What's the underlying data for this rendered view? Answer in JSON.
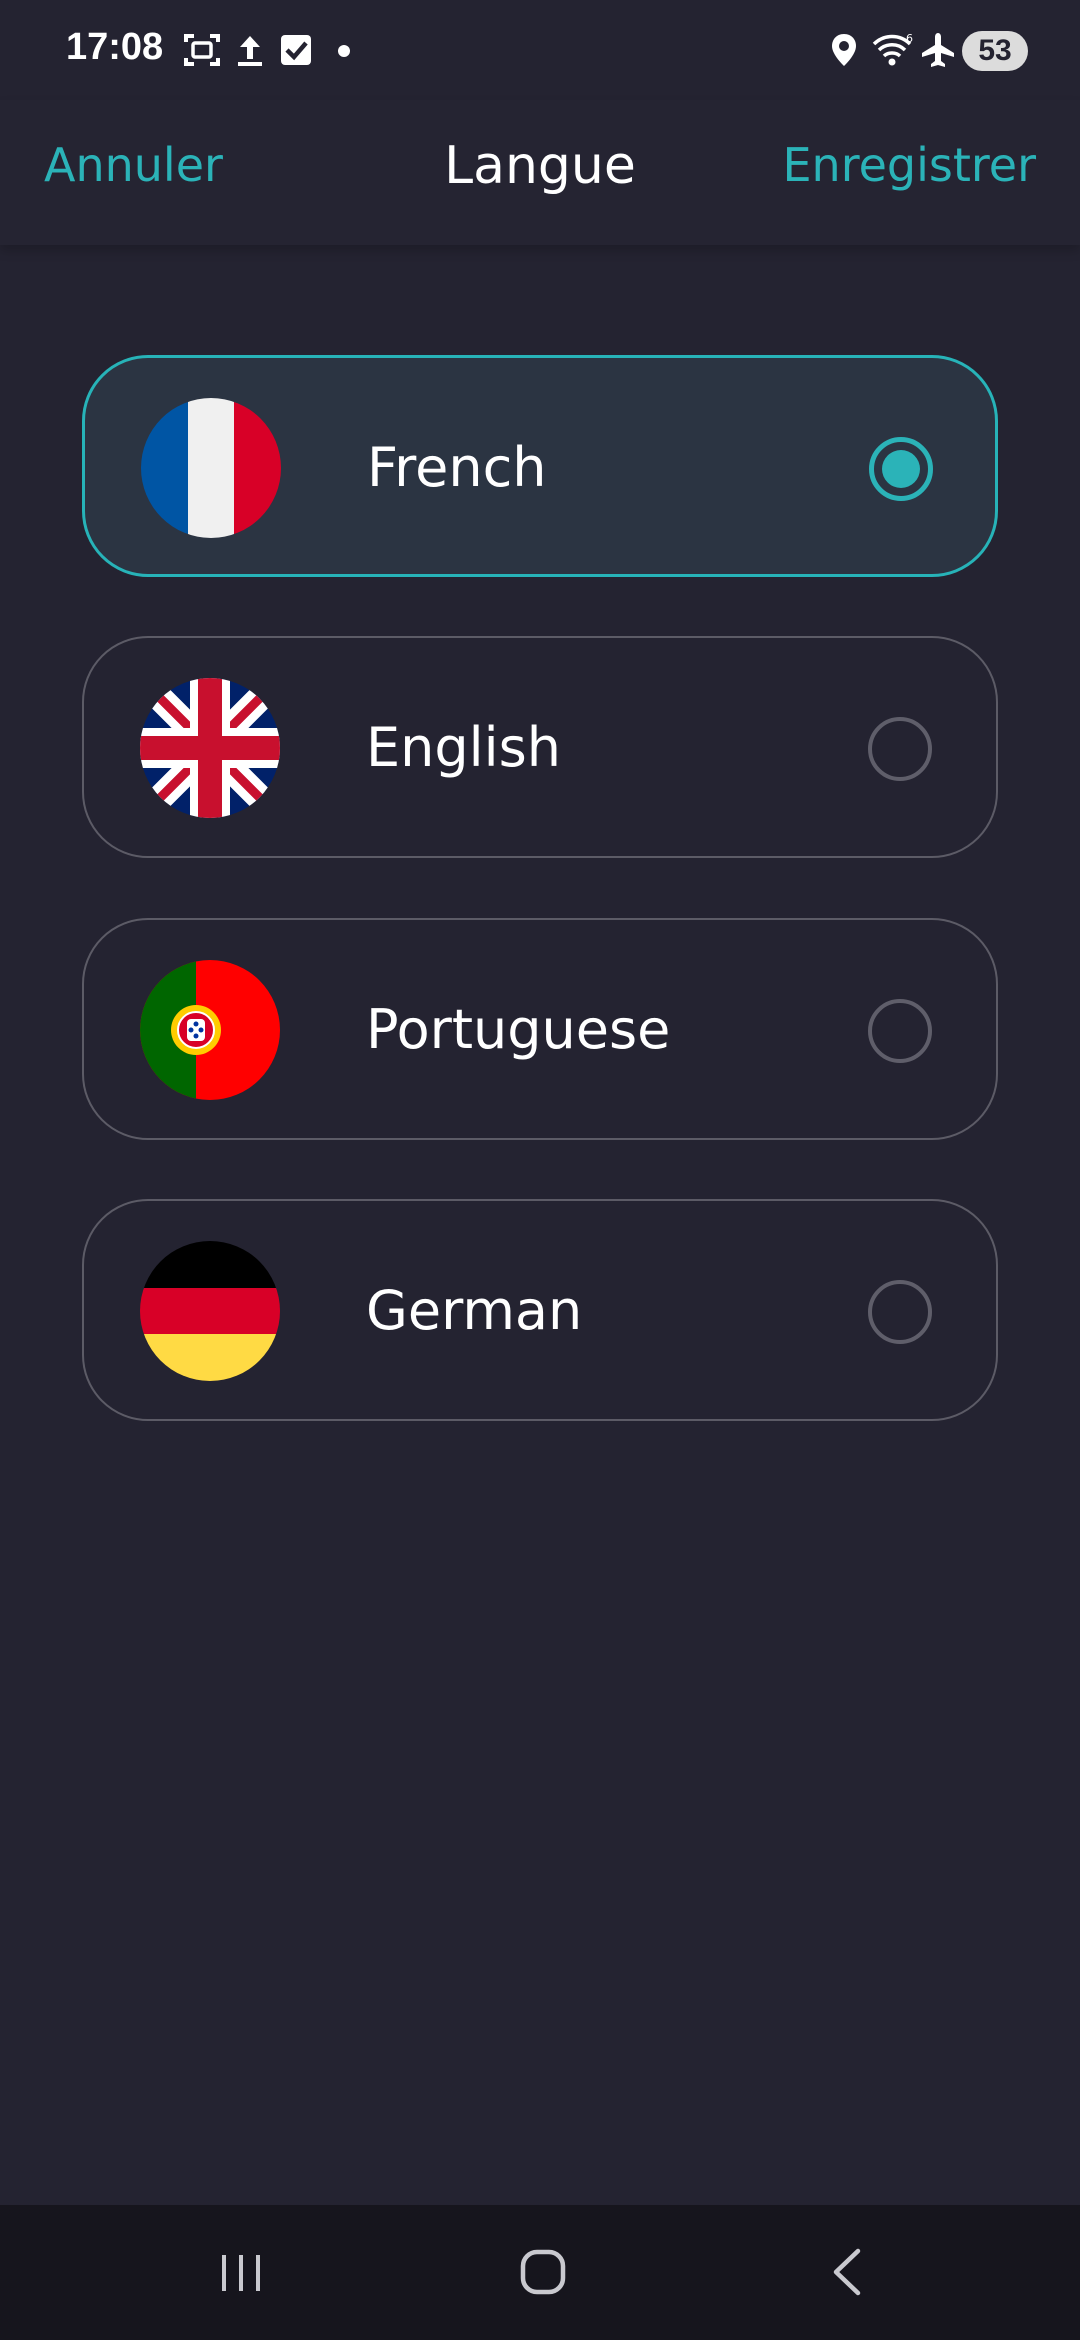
{
  "status_bar": {
    "time": "17:08",
    "battery": "53",
    "icons": [
      "screenshot-icon",
      "upload-icon",
      "checkbox-icon",
      "dot-icon",
      "location-icon",
      "wifi-icon",
      "airplane-icon",
      "battery-icon"
    ]
  },
  "header": {
    "cancel_label": "Annuler",
    "title": "Langue",
    "save_label": "Enregistrer"
  },
  "languages": [
    {
      "label": "French",
      "flag": "france-flag-icon",
      "selected": true
    },
    {
      "label": "English",
      "flag": "uk-flag-icon",
      "selected": false
    },
    {
      "label": "Portuguese",
      "flag": "portugal-flag-icon",
      "selected": false
    },
    {
      "label": "German",
      "flag": "germany-flag-icon",
      "selected": false
    }
  ],
  "nav_bar": {
    "buttons": [
      "recent-apps-icon",
      "home-icon",
      "back-icon"
    ]
  },
  "colors": {
    "accent": "#2bb3b8",
    "background": "#242331",
    "selected_card": "#2b3442"
  }
}
